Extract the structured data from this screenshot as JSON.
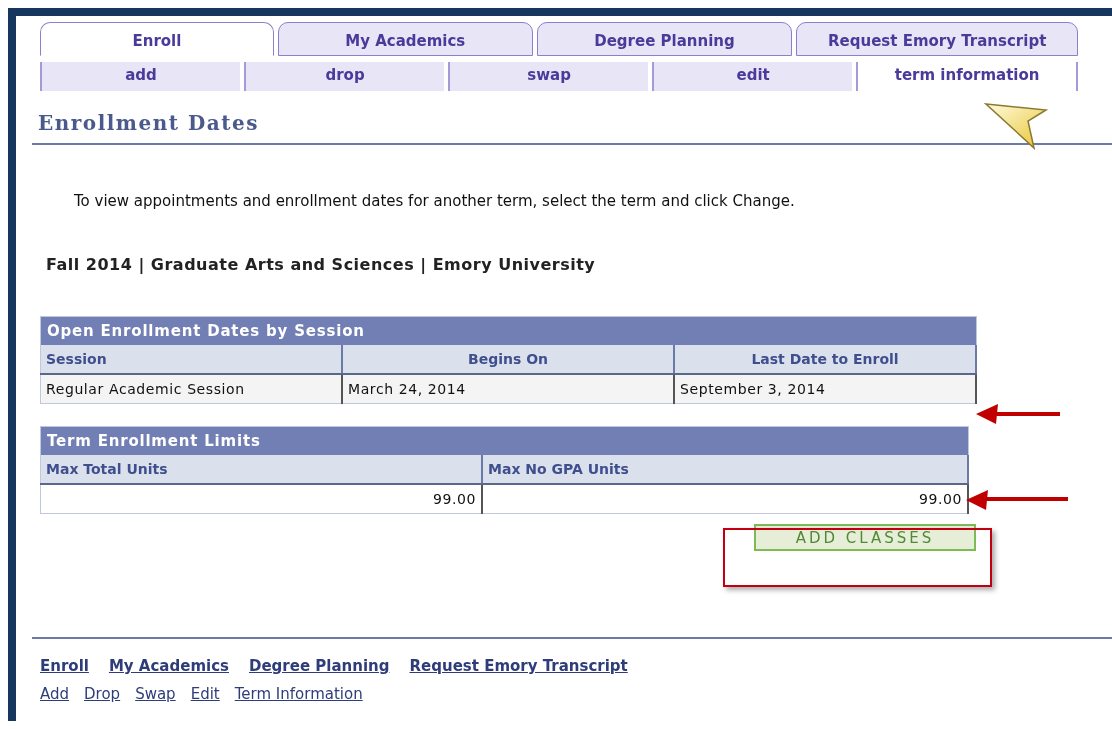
{
  "tabs": [
    {
      "label": "Enroll",
      "selected": true
    },
    {
      "label": "My Academics",
      "selected": false
    },
    {
      "label": "Degree Planning",
      "selected": false
    },
    {
      "label": "Request Emory Transcript",
      "selected": false
    }
  ],
  "subtabs": [
    {
      "label": "add",
      "selected": false
    },
    {
      "label": "drop",
      "selected": false
    },
    {
      "label": "swap",
      "selected": false
    },
    {
      "label": "edit",
      "selected": false
    },
    {
      "label": "term information",
      "selected": true
    }
  ],
  "page_title": "Enrollment Dates",
  "instructions": "To view appointments and enrollment dates for another term, select the term and click Change.",
  "term_line": "Fall 2014 | Graduate Arts and Sciences | Emory University",
  "tables": [
    {
      "title": "Open Enrollment Dates by Session",
      "kind": "dates",
      "columns": [
        "Session",
        "Begins On",
        "Last Date to Enroll"
      ],
      "rows": [
        [
          "Regular Academic Session",
          "March 24, 2014",
          "September 3, 2014"
        ]
      ]
    },
    {
      "title": "Term Enrollment Limits",
      "kind": "limits",
      "columns": [
        "Max Total Units",
        "Max No GPA Units"
      ],
      "rows": [
        [
          "99.00",
          "99.00"
        ]
      ]
    }
  ],
  "button": "ADD CLASSES",
  "footer_links": [
    [
      "Enroll",
      "My Academics",
      "Degree Planning",
      "Request Emory Transcript"
    ],
    [
      "Add",
      "Drop",
      "Swap",
      "Edit",
      "Term Information"
    ]
  ]
}
